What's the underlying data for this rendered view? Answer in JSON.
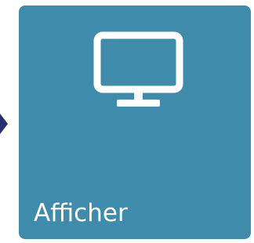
{
  "tile": {
    "label": "Afficher",
    "icon": "monitor-icon",
    "background_color": "#3f8bab",
    "foreground_color": "#ffffff"
  },
  "pointer": {
    "icon": "chevron-right-icon",
    "color": "#2a2d6e"
  }
}
